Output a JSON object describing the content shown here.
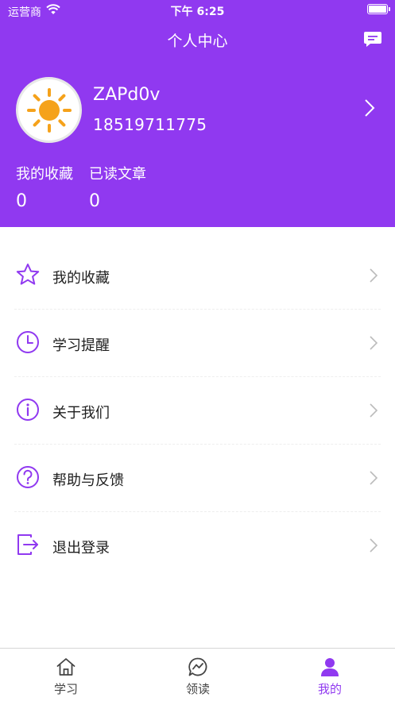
{
  "status_bar": {
    "carrier": "运营商",
    "time": "下午 6:25"
  },
  "header": {
    "title": "个人中心"
  },
  "profile": {
    "username": "ZAPd0v",
    "phone": "18519711775"
  },
  "stats": [
    {
      "label": "我的收藏",
      "value": "0"
    },
    {
      "label": "已读文章",
      "value": "0"
    }
  ],
  "menu": [
    {
      "label": "我的收藏",
      "icon": "star-icon"
    },
    {
      "label": "学习提醒",
      "icon": "clock-icon"
    },
    {
      "label": "关于我们",
      "icon": "info-icon"
    },
    {
      "label": "帮助与反馈",
      "icon": "help-icon"
    },
    {
      "label": "退出登录",
      "icon": "logout-icon"
    }
  ],
  "tabs": [
    {
      "label": "学习",
      "icon": "home-icon",
      "active": false
    },
    {
      "label": "领读",
      "icon": "chat-bubble-icon",
      "active": false
    },
    {
      "label": "我的",
      "icon": "user-icon",
      "active": true
    }
  ],
  "colors": {
    "accent": "#9039f0",
    "sun": "#f5a21b",
    "chevron": "#bbbbbb"
  }
}
